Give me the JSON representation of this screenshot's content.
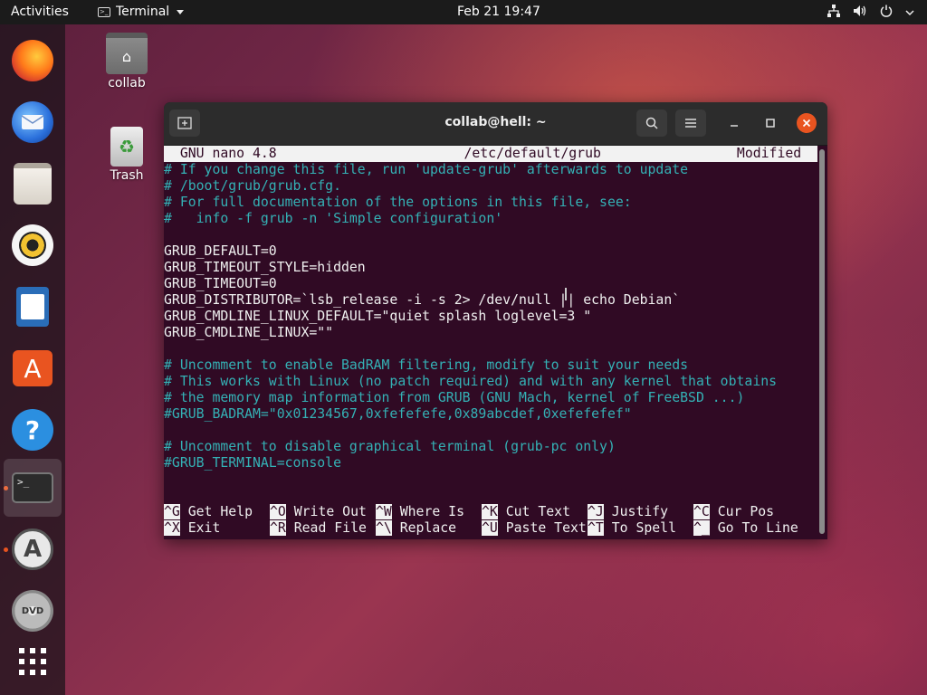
{
  "topbar": {
    "activities": "Activities",
    "app_name": "Terminal",
    "clock": "Feb 21  19:47",
    "tray_icons": [
      "network-icon",
      "volume-icon",
      "power-icon",
      "chevron-down-icon"
    ]
  },
  "dock": {
    "items": [
      "firefox",
      "thunderbird",
      "files",
      "rhythmbox",
      "libreoffice-writer",
      "ubuntu-software",
      "help",
      "terminal",
      "software-updater",
      "dvd",
      "show-applications"
    ]
  },
  "desktop": {
    "home_label": "collab",
    "trash_label": "Trash"
  },
  "window": {
    "title": "collab@hell: ~",
    "nano": {
      "version": "  GNU nano 4.8",
      "file": "/etc/default/grub",
      "status": "Modified  ",
      "lines": [
        {
          "text": "# If you change this file, run 'update-grub' afterwards to update",
          "kind": "comment"
        },
        {
          "text": "# /boot/grub/grub.cfg.",
          "kind": "comment"
        },
        {
          "text": "# For full documentation of the options in this file, see:",
          "kind": "comment"
        },
        {
          "text": "#   info -f grub -n 'Simple configuration'",
          "kind": "comment"
        },
        {
          "text": "",
          "kind": "plain"
        },
        {
          "text": "GRUB_DEFAULT=0",
          "kind": "plain"
        },
        {
          "text": "GRUB_TIMEOUT_STYLE=hidden",
          "kind": "plain"
        },
        {
          "text": "GRUB_TIMEOUT=0",
          "kind": "plain"
        },
        {
          "text": "GRUB_DISTRIBUTOR=`lsb_release -i -s 2> /dev/null || echo Debian`",
          "kind": "plain"
        },
        {
          "text": "GRUB_CMDLINE_LINUX_DEFAULT=\"quiet splash loglevel=3 \"",
          "kind": "plain"
        },
        {
          "text": "GRUB_CMDLINE_LINUX=\"\"",
          "kind": "plain"
        },
        {
          "text": "",
          "kind": "plain"
        },
        {
          "text": "# Uncomment to enable BadRAM filtering, modify to suit your needs",
          "kind": "comment"
        },
        {
          "text": "# This works with Linux (no patch required) and with any kernel that obtains",
          "kind": "comment"
        },
        {
          "text": "# the memory map information from GRUB (GNU Mach, kernel of FreeBSD ...)",
          "kind": "comment"
        },
        {
          "text": "#GRUB_BADRAM=\"0x01234567,0xfefefefe,0x89abcdef,0xefefefef\"",
          "kind": "comment"
        },
        {
          "text": "",
          "kind": "plain"
        },
        {
          "text": "# Uncomment to disable graphical terminal (grub-pc only)",
          "kind": "comment"
        },
        {
          "text": "#GRUB_TERMINAL=console",
          "kind": "comment"
        }
      ],
      "shortcuts": [
        [
          {
            "key": "^G",
            "label": " Get Help"
          },
          {
            "key": "^O",
            "label": " Write Out"
          },
          {
            "key": "^W",
            "label": " Where Is"
          },
          {
            "key": "^K",
            "label": " Cut Text"
          },
          {
            "key": "^J",
            "label": " Justify"
          },
          {
            "key": "^C",
            "label": " Cur Pos"
          }
        ],
        [
          {
            "key": "^X",
            "label": " Exit"
          },
          {
            "key": "^R",
            "label": " Read File"
          },
          {
            "key": "^\\",
            "label": " Replace"
          },
          {
            "key": "^U",
            "label": " Paste Text"
          },
          {
            "key": "^T",
            "label": " To Spell"
          },
          {
            "key": "^_",
            "label": " Go To Line"
          }
        ]
      ]
    }
  },
  "colors": {
    "terminal_bg": "#300a24",
    "comment": "#34b1b5",
    "accent": "#e95420"
  }
}
